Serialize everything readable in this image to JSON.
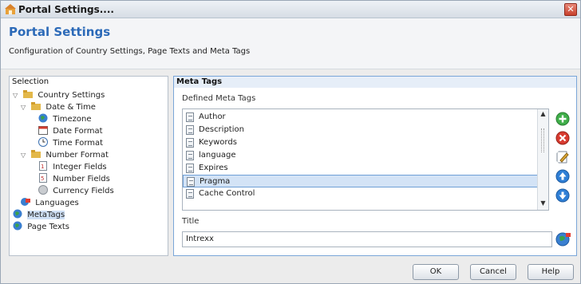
{
  "window": {
    "title": "Portal Settings...."
  },
  "header": {
    "title": "Portal Settings",
    "subtitle": "Configuration of Country Settings, Page Texts and Meta Tags"
  },
  "selection": {
    "heading": "Selection",
    "items": [
      {
        "label": "Country Settings",
        "icon": "folder-icon"
      },
      {
        "label": "Date & Time",
        "icon": "folder-icon"
      },
      {
        "label": "Timezone",
        "icon": "globe-icon"
      },
      {
        "label": "Date Format",
        "icon": "calendar-icon"
      },
      {
        "label": "Time Format",
        "icon": "clock-icon"
      },
      {
        "label": "Number Format",
        "icon": "folder-icon"
      },
      {
        "label": "Integer Fields",
        "icon": "number-icon"
      },
      {
        "label": "Number Fields",
        "icon": "number-icon"
      },
      {
        "label": "Currency Fields",
        "icon": "coin-icon"
      },
      {
        "label": "Languages",
        "icon": "language-icon"
      },
      {
        "label": "MetaTags",
        "icon": "globe-icon"
      },
      {
        "label": "Page Texts",
        "icon": "globe-icon"
      }
    ]
  },
  "metatags": {
    "heading": "Meta Tags",
    "list_label": "Defined Meta Tags",
    "items": [
      "Author",
      "Description",
      "Keywords",
      "language",
      "Expires",
      "Pragma",
      "Cache Control"
    ],
    "selected": "Pragma",
    "title_label": "Title",
    "title_value": "Intrexx"
  },
  "footer": {
    "ok": "OK",
    "cancel": "Cancel",
    "help": "Help"
  },
  "colors": {
    "accent": "#2c6ab8",
    "selection": "#d3e3f6"
  }
}
